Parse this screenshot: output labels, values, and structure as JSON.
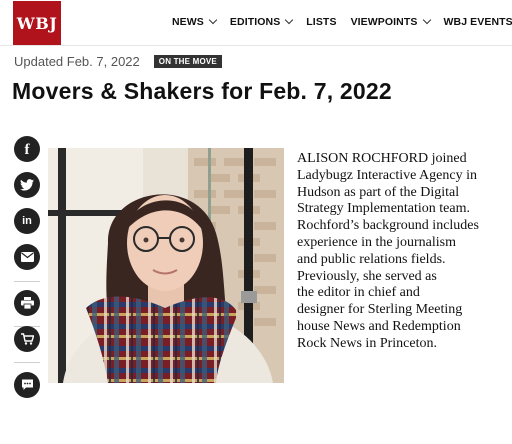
{
  "header": {
    "logo_text": "WBJ",
    "nav": [
      {
        "label": "NEWS",
        "dropdown": true
      },
      {
        "label": "EDITIONS",
        "dropdown": true
      },
      {
        "label": "LISTS",
        "dropdown": false
      },
      {
        "label": "VIEWPOINTS",
        "dropdown": true
      },
      {
        "label": "WBJ EVENTS",
        "dropdown": true
      }
    ]
  },
  "article": {
    "updated": "Updated Feb. 7, 2022",
    "tag": "ON THE MOVE",
    "title": "Movers & Shakers for Feb. 7, 2022",
    "body_lines": [
      "ALISON ROCHFORD joined",
      "Ladybugz Interactive Agency in",
      "Hudson as part of the Digital",
      "Strategy Implementation team.",
      "Rochford’s background includes",
      "experience in the journalism",
      "and public relations fields.",
      "Previously, she served as",
      "the editor in chief and",
      "designer for Sterling Meeting",
      "house News and Redemption",
      "Rock News in Princeton."
    ]
  },
  "share": {
    "icons": [
      "facebook-icon",
      "twitter-icon",
      "linkedin-icon",
      "email-icon",
      "print-icon",
      "cart-icon",
      "comment-icon"
    ]
  },
  "colors": {
    "brand_red": "#b1131c",
    "share_bg": "#222222",
    "badge_bg": "#333333"
  }
}
